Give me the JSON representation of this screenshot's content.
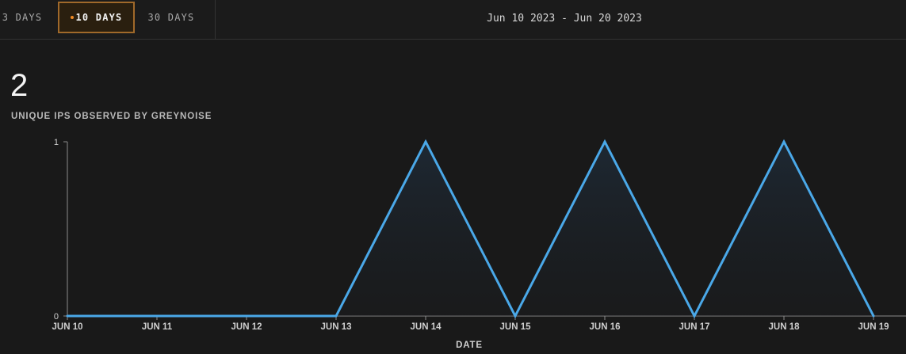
{
  "range_tabs": {
    "three_days": "3 DAYS",
    "ten_days": "10 DAYS",
    "thirty_days": "30 DAYS",
    "active": "10 DAYS"
  },
  "date_range": "Jun 10 2023 - Jun 20 2023",
  "summary": {
    "count": "2",
    "label": "UNIQUE IPS OBSERVED BY GREYNOISE"
  },
  "colors": {
    "line": "#4aa8e8",
    "active_tab_border": "#a0692a",
    "active_dot": "#f08a24"
  },
  "chart_data": {
    "type": "area",
    "title": "",
    "xlabel": "DATE",
    "ylabel": "",
    "categories": [
      "JUN 10",
      "JUN 11",
      "JUN 12",
      "JUN 13",
      "JUN 14",
      "JUN 15",
      "JUN 16",
      "JUN 17",
      "JUN 18",
      "JUN 19"
    ],
    "values": [
      0,
      0,
      0,
      0,
      1,
      0,
      1,
      0,
      1,
      0
    ],
    "yticks": [
      "0",
      "1"
    ],
    "ylim": [
      0,
      1
    ],
    "grid": false
  }
}
